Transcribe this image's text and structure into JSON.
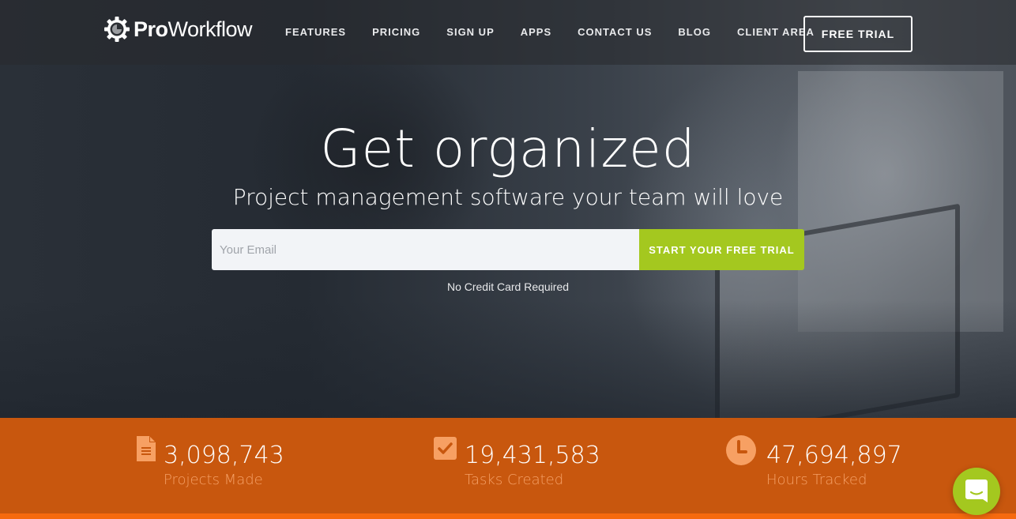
{
  "brand": {
    "name_bold": "Pro",
    "name_regular": "Workflow"
  },
  "nav": {
    "links": [
      "FEATURES",
      "PRICING",
      "SIGN UP",
      "APPS",
      "CONTACT US",
      "BLOG",
      "CLIENT AREA"
    ],
    "cta_label": "FREE TRIAL"
  },
  "hero": {
    "headline": "Get organized",
    "subheadline": "Project management software your team will love",
    "email_placeholder": "Your Email",
    "email_value": "",
    "cta_label": "START YOUR FREE TRIAL",
    "note": "No Credit Card Required"
  },
  "stats": [
    {
      "icon": "document-icon",
      "value": "3,098,743",
      "label": "Projects Made"
    },
    {
      "icon": "checkbox-icon",
      "value": "19,431,583",
      "label": "Tasks Created"
    },
    {
      "icon": "clock-icon",
      "value": "47,694,897",
      "label": "Hours Tracked"
    }
  ],
  "colors": {
    "accent_green": "#a4c81f",
    "stats_orange": "#c8570e",
    "stats_label": "#f5a066",
    "strip_orange": "#f66a0f"
  },
  "chat": {
    "icon": "chat-bubble-icon"
  }
}
